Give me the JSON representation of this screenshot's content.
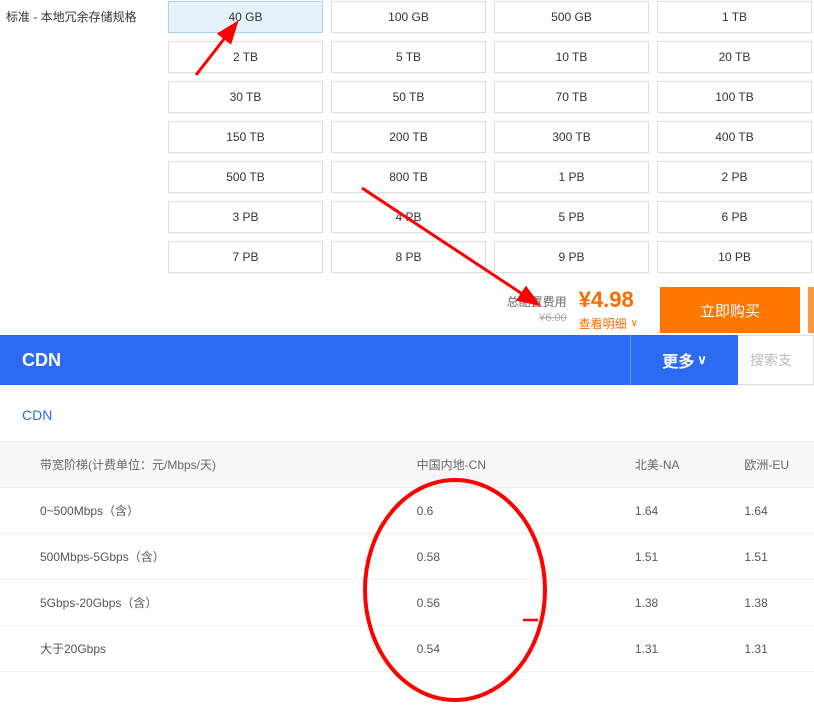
{
  "storage": {
    "label": "标准 - 本地冗余存储规格",
    "selected_index": 0,
    "options": [
      "40 GB",
      "100 GB",
      "500 GB",
      "1 TB",
      "2 TB",
      "5 TB",
      "10 TB",
      "20 TB",
      "30 TB",
      "50 TB",
      "70 TB",
      "100 TB",
      "150 TB",
      "200 TB",
      "300 TB",
      "400 TB",
      "500 TB",
      "800 TB",
      "1 PB",
      "2 PB",
      "3 PB",
      "4 PB",
      "5 PB",
      "6 PB",
      "7 PB",
      "8 PB",
      "9 PB",
      "10 PB"
    ]
  },
  "price": {
    "label": "总配置费用",
    "value": "¥4.98",
    "original": "¥6.00",
    "detail_label": "查看明细"
  },
  "buy_label": "立即购买",
  "cdn": {
    "title": "CDN",
    "more_label": "更多",
    "search_placeholder": "搜索支"
  },
  "subnav": {
    "item": "CDN"
  },
  "pricing_table": {
    "headers": {
      "tier": "带宽阶梯(计费单位：元/Mbps/天)",
      "cn": "中国内地-CN",
      "na": "北美-NA",
      "eu": "欧洲-EU"
    },
    "rows": [
      {
        "tier": "0~500Mbps（含）",
        "cn": "0.6",
        "na": "1.64",
        "eu": "1.64"
      },
      {
        "tier": "500Mbps-5Gbps（含）",
        "cn": "0.58",
        "na": "1.51",
        "eu": "1.51"
      },
      {
        "tier": "5Gbps-20Gbps（含）",
        "cn": "0.56",
        "na": "1.38",
        "eu": "1.38"
      },
      {
        "tier": "大于20Gbps",
        "cn": "0.54",
        "na": "1.31",
        "eu": "1.31"
      }
    ]
  }
}
